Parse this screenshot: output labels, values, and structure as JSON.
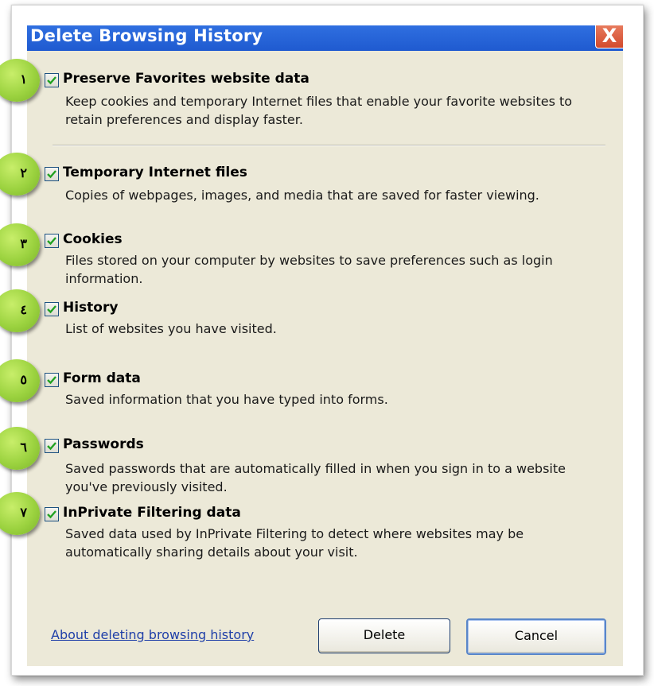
{
  "dialog": {
    "title": "Delete Browsing History",
    "close_label": "X"
  },
  "options": [
    {
      "badge": "١",
      "checked": true,
      "title": "Preserve Favorites website data",
      "desc": "Keep cookies and temporary Internet files that enable your favorite websites to retain preferences and display faster."
    },
    {
      "badge": "٢",
      "checked": true,
      "title": "Temporary Internet files",
      "desc": "Copies of webpages, images, and media that are saved for faster viewing."
    },
    {
      "badge": "٣",
      "checked": true,
      "title": "Cookies",
      "desc": "Files stored on your computer by websites to save preferences such as login information."
    },
    {
      "badge": "٤",
      "checked": true,
      "title": "History",
      "desc": "List of websites you have visited."
    },
    {
      "badge": "٥",
      "checked": true,
      "title": "Form data",
      "desc": "Saved information that you have typed into forms."
    },
    {
      "badge": "٦",
      "checked": true,
      "title": "Passwords",
      "desc": "Saved passwords that are automatically filled in when you sign in to a website you've previously visited."
    },
    {
      "badge": "٧",
      "checked": true,
      "title": "InPrivate Filtering data",
      "desc": "Saved data used by InPrivate Filtering to detect where websites may be automatically sharing details about your visit."
    }
  ],
  "footer": {
    "link": "About deleting browsing history",
    "delete_label": "Delete",
    "cancel_label": "Cancel"
  },
  "colors": {
    "titlebar": "#2160d8",
    "dialog_bg": "#ece9d8",
    "badge": "#9cd340",
    "link": "#1f3fa8"
  }
}
